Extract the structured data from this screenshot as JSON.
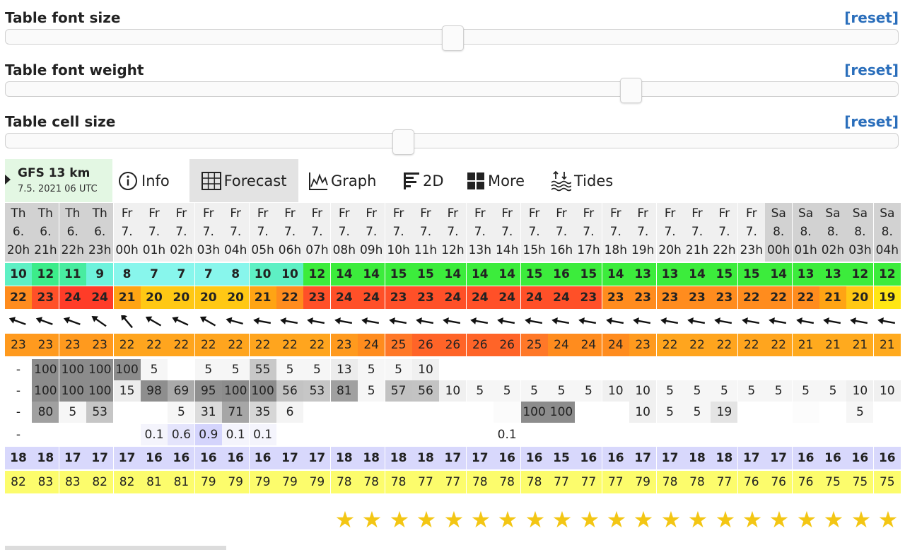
{
  "sliders": [
    {
      "label": "Table font size",
      "reset": "[reset]",
      "value": 0.5
    },
    {
      "label": "Table font weight",
      "reset": "[reset]",
      "value": 0.7
    },
    {
      "label": "Table cell size",
      "reset": "[reset]",
      "value": 0.445
    }
  ],
  "model": {
    "name": "GFS 13 km",
    "date": "7.5. 2021 06 UTC"
  },
  "tabs": [
    {
      "label": "Info",
      "icon": "info-icon",
      "active": false
    },
    {
      "label": "Forecast",
      "icon": "grid-icon",
      "active": true
    },
    {
      "label": "Graph",
      "icon": "graph-icon",
      "active": false
    },
    {
      "label": "2D",
      "icon": "2d-icon",
      "active": false
    },
    {
      "label": "More",
      "icon": "more-icon",
      "active": false
    },
    {
      "label": "Tides",
      "icon": "tides-icon",
      "active": false
    }
  ],
  "forecast": {
    "days": [
      "Th",
      "Th",
      "Th",
      "Th",
      "Fr",
      "Fr",
      "Fr",
      "Fr",
      "Fr",
      "Fr",
      "Fr",
      "Fr",
      "Fr",
      "Fr",
      "Fr",
      "Fr",
      "Fr",
      "Fr",
      "Fr",
      "Fr",
      "Fr",
      "Fr",
      "Fr",
      "Fr",
      "Fr",
      "Fr",
      "Fr",
      "Fr",
      "Sa",
      "Sa",
      "Sa",
      "Sa",
      "Sa"
    ],
    "dates": [
      "6.",
      "6.",
      "6.",
      "6.",
      "7.",
      "7.",
      "7.",
      "7.",
      "7.",
      "7.",
      "7.",
      "7.",
      "7.",
      "7.",
      "7.",
      "7.",
      "7.",
      "7.",
      "7.",
      "7.",
      "7.",
      "7.",
      "7.",
      "7.",
      "7.",
      "7.",
      "7.",
      "7.",
      "8.",
      "8.",
      "8.",
      "8.",
      "8."
    ],
    "hours": [
      "20h",
      "21h",
      "22h",
      "23h",
      "00h",
      "01h",
      "02h",
      "03h",
      "04h",
      "05h",
      "06h",
      "07h",
      "08h",
      "09h",
      "10h",
      "11h",
      "12h",
      "13h",
      "14h",
      "15h",
      "16h",
      "17h",
      "18h",
      "19h",
      "20h",
      "21h",
      "22h",
      "23h",
      "00h",
      "01h",
      "02h",
      "03h",
      "04h"
    ],
    "header_bg": [
      "#d2d2d2",
      "#d2d2d2",
      "#d2d2d2",
      "#d2d2d2",
      "#f0f0f0",
      "#f0f0f0",
      "#f0f0f0",
      "#f0f0f0",
      "#f0f0f0",
      "#f0f0f0",
      "#f0f0f0",
      "#f0f0f0",
      "#f0f0f0",
      "#f0f0f0",
      "#f0f0f0",
      "#f0f0f0",
      "#f0f0f0",
      "#f0f0f0",
      "#f0f0f0",
      "#f0f0f0",
      "#f0f0f0",
      "#f0f0f0",
      "#f0f0f0",
      "#f0f0f0",
      "#f0f0f0",
      "#f0f0f0",
      "#f0f0f0",
      "#f0f0f0",
      "#d2d2d2",
      "#d2d2d2",
      "#d2d2d2",
      "#d2d2d2",
      "#d2d2d2"
    ],
    "wind_speed": {
      "values": [
        "10",
        "12",
        "11",
        "9",
        "8",
        "7",
        "7",
        "7",
        "8",
        "10",
        "10",
        "12",
        "14",
        "14",
        "15",
        "15",
        "14",
        "14",
        "14",
        "15",
        "16",
        "15",
        "14",
        "13",
        "13",
        "14",
        "15",
        "15",
        "14",
        "13",
        "13",
        "12",
        "12"
      ],
      "colors": [
        "#5ef0c4",
        "#3cec8a",
        "#48eca0",
        "#6ef2dc",
        "#88f6ec",
        "#88f6ec",
        "#88f6ec",
        "#88f6ec",
        "#88f6ec",
        "#5ef0c4",
        "#5ef0c4",
        "#3cec3c",
        "#3cec3c",
        "#3cec3c",
        "#3cec3c",
        "#3cec3c",
        "#3cec3c",
        "#3cec3c",
        "#3cec3c",
        "#3cec3c",
        "#3cec3c",
        "#3cec3c",
        "#3cec3c",
        "#3cec3c",
        "#3cec3c",
        "#3cec3c",
        "#3cec3c",
        "#3cec3c",
        "#3cec3c",
        "#3cec3c",
        "#3cec3c",
        "#3cec3c",
        "#3cec3c"
      ]
    },
    "wind_gusts": {
      "values": [
        "22",
        "23",
        "24",
        "24",
        "21",
        "20",
        "20",
        "20",
        "20",
        "21",
        "22",
        "23",
        "24",
        "24",
        "23",
        "23",
        "24",
        "24",
        "24",
        "24",
        "24",
        "23",
        "23",
        "23",
        "23",
        "23",
        "23",
        "22",
        "22",
        "22",
        "21",
        "20",
        "19"
      ],
      "colors": [
        "#ff8c1e",
        "#ff5028",
        "#ff3c28",
        "#ff3c28",
        "#ffa414",
        "#ffc814",
        "#ffc814",
        "#ffc814",
        "#ffc814",
        "#ffa414",
        "#ff8c1e",
        "#ff5028",
        "#ff5028",
        "#ff5028",
        "#ff5028",
        "#ff5028",
        "#ff5028",
        "#ff5028",
        "#ff5028",
        "#ff5028",
        "#ff5028",
        "#ff5028",
        "#ff8c1e",
        "#ff8c1e",
        "#ff8c1e",
        "#ff8c1e",
        "#ff8c1e",
        "#ff8c1e",
        "#ff8c1e",
        "#ff8c1e",
        "#ffa414",
        "#ffc814",
        "#ffe614"
      ]
    },
    "wind_dir_deg": [
      110,
      110,
      110,
      125,
      140,
      120,
      115,
      120,
      105,
      100,
      100,
      100,
      100,
      100,
      100,
      100,
      100,
      100,
      100,
      100,
      100,
      100,
      100,
      100,
      100,
      100,
      100,
      100,
      100,
      100,
      100,
      100,
      100
    ],
    "temperature": {
      "values": [
        "23",
        "23",
        "23",
        "23",
        "22",
        "22",
        "22",
        "22",
        "22",
        "22",
        "22",
        "22",
        "23",
        "24",
        "25",
        "26",
        "26",
        "26",
        "26",
        "25",
        "24",
        "24",
        "24",
        "23",
        "22",
        "22",
        "22",
        "22",
        "22",
        "21",
        "21",
        "21",
        "21"
      ],
      "colors": [
        "#ff9a1e",
        "#ff9a1e",
        "#ff9a1e",
        "#ff9a1e",
        "#ffa51e",
        "#ffa51e",
        "#ffa51e",
        "#ffa51e",
        "#ffa51e",
        "#ffa51e",
        "#ffa51e",
        "#ffa51e",
        "#ff9a1e",
        "#ff8c1e",
        "#ff7828",
        "#ff6428",
        "#ff6428",
        "#ff6428",
        "#ff6428",
        "#ff7828",
        "#ff8c1e",
        "#ff8c1e",
        "#ff8c1e",
        "#ff9a1e",
        "#ffa51e",
        "#ffa51e",
        "#ffa51e",
        "#ffa51e",
        "#ffa51e",
        "#ffaa1e",
        "#ffaa1e",
        "#ffaa1e",
        "#ffaa1e"
      ]
    },
    "cloud_high": {
      "values": [
        "-",
        "100",
        "100",
        "100",
        "100",
        "5",
        "",
        "5",
        "5",
        "55",
        "5",
        "5",
        "13",
        "5",
        "5",
        "10",
        "",
        "",
        "",
        "",
        "",
        "",
        "",
        "",
        "",
        "",
        "",
        "",
        "",
        "",
        "",
        "",
        ""
      ],
      "colors": [
        "#ffffff",
        "#8c8c8c",
        "#8c8c8c",
        "#8c8c8c",
        "#8c8c8c",
        "#f6f6f6",
        "#ffffff",
        "#f6f6f6",
        "#f6f6f6",
        "#c8c8c8",
        "#f6f6f6",
        "#f6f6f6",
        "#ececec",
        "#f6f6f6",
        "#f6f6f6",
        "#f0f0f0",
        "#ffffff",
        "#ffffff",
        "#ffffff",
        "#ffffff",
        "#ffffff",
        "#ffffff",
        "#ffffff",
        "#ffffff",
        "#ffffff",
        "#ffffff",
        "#ffffff",
        "#ffffff",
        "#ffffff",
        "#ffffff",
        "#ffffff",
        "#ffffff",
        "#ffffff"
      ]
    },
    "cloud_mid": {
      "values": [
        "-",
        "100",
        "100",
        "100",
        "15",
        "98",
        "69",
        "95",
        "100",
        "100",
        "56",
        "53",
        "81",
        "5",
        "57",
        "56",
        "10",
        "5",
        "5",
        "5",
        "5",
        "5",
        "10",
        "10",
        "5",
        "5",
        "5",
        "5",
        "5",
        "5",
        "5",
        "10",
        "10"
      ],
      "colors": [
        "#ffffff",
        "#8c8c8c",
        "#8c8c8c",
        "#8c8c8c",
        "#ececec",
        "#8e8e8e",
        "#aaaaaa",
        "#909090",
        "#8c8c8c",
        "#8c8c8c",
        "#c3c3c3",
        "#c6c6c6",
        "#a0a0a0",
        "#f6f6f6",
        "#c2c2c2",
        "#c3c3c3",
        "#f0f0f0",
        "#f6f6f6",
        "#f6f6f6",
        "#f6f6f6",
        "#f6f6f6",
        "#f6f6f6",
        "#f0f0f0",
        "#f0f0f0",
        "#f6f6f6",
        "#f6f6f6",
        "#f6f6f6",
        "#f6f6f6",
        "#f6f6f6",
        "#f6f6f6",
        "#f6f6f6",
        "#f0f0f0",
        "#f0f0f0"
      ]
    },
    "cloud_low": {
      "values": [
        "-",
        "80",
        "5",
        "53",
        "",
        "",
        "5",
        "31",
        "71",
        "35",
        "6",
        "",
        "",
        "",
        "",
        "",
        "",
        "",
        "",
        "100",
        "100",
        "",
        "",
        "10",
        "5",
        "5",
        "19",
        "",
        "",
        "",
        "",
        "5",
        ""
      ],
      "colors": [
        "#ffffff",
        "#a0a0a0",
        "#f6f6f6",
        "#c6c6c6",
        "#ffffff",
        "#ffffff",
        "#f6f6f6",
        "#dcdcdc",
        "#a6a6a6",
        "#d6d6d6",
        "#f4f4f4",
        "#ffffff",
        "#ffffff",
        "#ffffff",
        "#ffffff",
        "#ffffff",
        "#ffffff",
        "#ffffff",
        "#fbfbfb",
        "#8c8c8c",
        "#8c8c8c",
        "#ffffff",
        "#ffffff",
        "#f0f0f0",
        "#f6f6f6",
        "#f6f6f6",
        "#e4e4e4",
        "#ffffff",
        "#ffffff",
        "#fcfcfc",
        "#ffffff",
        "#f6f6f6",
        "#ffffff"
      ]
    },
    "precipitation": {
      "values": [
        "-",
        "",
        "",
        "",
        "",
        "0.1",
        "0.6",
        "0.9",
        "0.1",
        "0.1",
        "",
        "",
        "",
        "",
        "",
        "",
        "",
        "",
        "0.1",
        "",
        "",
        "",
        "",
        "",
        "",
        "",
        "",
        "",
        "",
        "",
        "",
        "",
        ""
      ],
      "colors": [
        "#ffffff",
        "#ffffff",
        "#ffffff",
        "#ffffff",
        "#ffffff",
        "#f4f4fc",
        "#e4e4fc",
        "#d4d4fc",
        "#f4f4fc",
        "#f4f4fc",
        "#ffffff",
        "#ffffff",
        "#ffffff",
        "#ffffff",
        "#ffffff",
        "#ffffff",
        "#ffffff",
        "#ffffff",
        "#ffffff",
        "#ffffff",
        "#ffffff",
        "#ffffff",
        "#ffffff",
        "#ffffff",
        "#ffffff",
        "#ffffff",
        "#ffffff",
        "#ffffff",
        "#ffffff",
        "#ffffff",
        "#ffffff",
        "#ffffff",
        "#ffffff"
      ]
    },
    "water_temp": {
      "values": [
        "18",
        "18",
        "17",
        "17",
        "17",
        "16",
        "16",
        "16",
        "16",
        "16",
        "17",
        "17",
        "18",
        "18",
        "18",
        "18",
        "17",
        "17",
        "16",
        "16",
        "15",
        "16",
        "16",
        "17",
        "17",
        "18",
        "18",
        "17",
        "17",
        "16",
        "16",
        "16",
        "16"
      ],
      "color": "#d8d8fc"
    },
    "humidity": {
      "values": [
        "82",
        "83",
        "83",
        "82",
        "82",
        "81",
        "81",
        "79",
        "79",
        "79",
        "79",
        "79",
        "78",
        "78",
        "78",
        "77",
        "77",
        "78",
        "78",
        "78",
        "77",
        "77",
        "77",
        "79",
        "78",
        "78",
        "77",
        "76",
        "76",
        "76",
        "75",
        "75",
        "75"
      ],
      "color": "#fcfc6c"
    }
  },
  "rating": {
    "stars": "★",
    "count": 21
  }
}
